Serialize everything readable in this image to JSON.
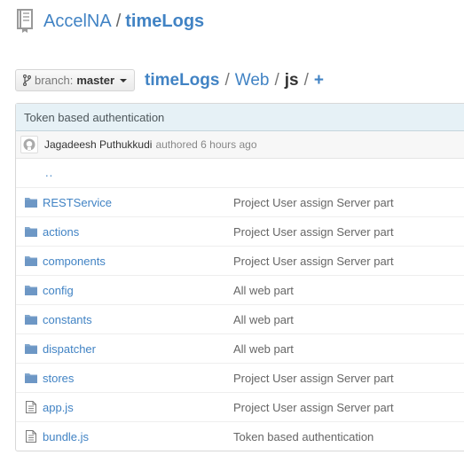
{
  "repo": {
    "owner": "AccelNA",
    "separator": "/",
    "name": "timeLogs"
  },
  "branch": {
    "label": "branch:",
    "value": "master"
  },
  "breadcrumb": {
    "root": "timeLogs",
    "sep1": "/",
    "dir1": "Web",
    "sep2": "/",
    "current": "js",
    "sep3": "/",
    "add": "+"
  },
  "commit": {
    "message": "Token based authentication",
    "author": "Jagadeesh Puthukkudi",
    "action": "authored 6 hours ago"
  },
  "parent_link": "..",
  "files": [
    {
      "type": "folder",
      "name": "RESTService",
      "message": "Project User assign Server part"
    },
    {
      "type": "folder",
      "name": "actions",
      "message": "Project User assign Server part"
    },
    {
      "type": "folder",
      "name": "components",
      "message": "Project User assign Server part"
    },
    {
      "type": "folder",
      "name": "config",
      "message": "All web part"
    },
    {
      "type": "folder",
      "name": "constants",
      "message": "All web part"
    },
    {
      "type": "folder",
      "name": "dispatcher",
      "message": "All web part"
    },
    {
      "type": "folder",
      "name": "stores",
      "message": "Project User assign Server part"
    },
    {
      "type": "file",
      "name": "app.js",
      "message": "Project User assign Server part"
    },
    {
      "type": "file",
      "name": "bundle.js",
      "message": "Token based authentication"
    }
  ],
  "icons": {
    "repo": "repo-book-icon",
    "branch": "git-branch-icon",
    "folder": "folder-icon",
    "file": "file-text-icon",
    "avatar": "github-octocat-icon"
  },
  "colors": {
    "link": "#4183c4",
    "folder": "#80a6cd",
    "commit_bg": "#e6f1f6"
  }
}
